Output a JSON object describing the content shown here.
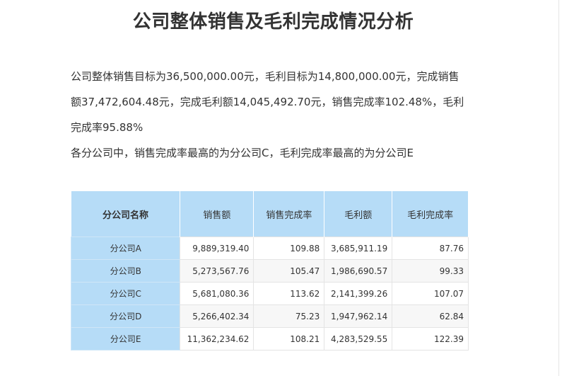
{
  "title": "公司整体销售及毛利完成情况分析",
  "summary": {
    "line1": "公司整体销售目标为36,500,000.00元，毛利目标为14,800,000.00元，完成销售",
    "line2": "额37,472,604.48元，完成毛利额14,045,492.70元，销售完成率102.48%，毛利",
    "line3": "完成率95.88%",
    "line4": "各分公司中，销售完成率最高的为分公司C，毛利完成率最高的为分公司E"
  },
  "table": {
    "headers": [
      "分公司名称",
      "销售额",
      "销售完成率",
      "毛利额",
      "毛利完成率"
    ],
    "rows": [
      [
        "分公司A",
        "9,889,319.40",
        "109.88",
        "3,685,911.19",
        "87.76"
      ],
      [
        "分公司B",
        "5,273,567.76",
        "105.47",
        "1,986,690.57",
        "99.33"
      ],
      [
        "分公司C",
        "5,681,080.36",
        "113.62",
        "2,141,399.26",
        "107.07"
      ],
      [
        "分公司D",
        "5,266,402.34",
        "75.23",
        "1,947,962.14",
        "62.84"
      ],
      [
        "分公司E",
        "11,362,234.62",
        "108.21",
        "4,283,529.55",
        "122.39"
      ]
    ]
  },
  "colors": {
    "header_bg": "#b6dcf7",
    "title_text": "#333333"
  }
}
